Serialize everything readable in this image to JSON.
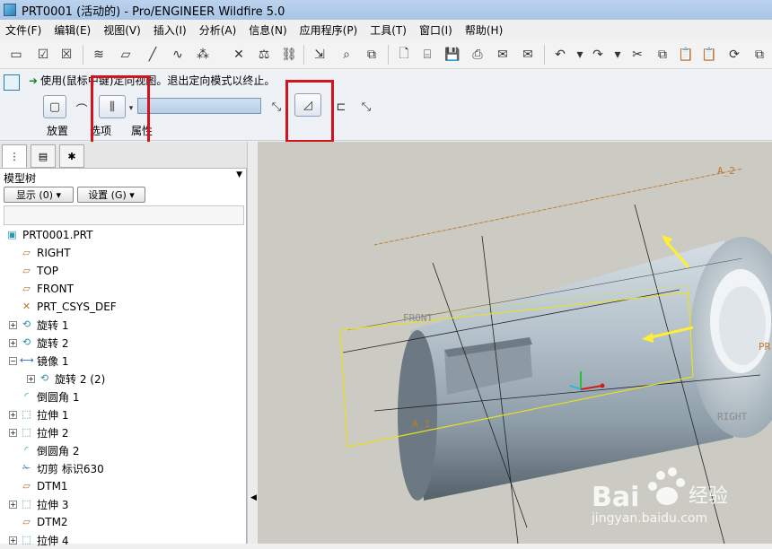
{
  "window": {
    "title": "PRT0001 (活动的) - Pro/ENGINEER Wildfire 5.0"
  },
  "menu": [
    "文件(F)",
    "编辑(E)",
    "视图(V)",
    "插入(I)",
    "分析(A)",
    "信息(N)",
    "应用程序(P)",
    "工具(T)",
    "窗口(I)",
    "帮助(H)"
  ],
  "dashboard": {
    "message": "使用(鼠标中键)定向视图。退出定向模式以终止。",
    "tabs": [
      "放置",
      "选项",
      "属性"
    ]
  },
  "panel": {
    "tree_header": "模型树",
    "show_button": "显示 (0) ▾",
    "settings_button": "设置 (G) ▾"
  },
  "tree": [
    {
      "label": "PRT0001.PRT",
      "icon": "part-icon",
      "expandable": false,
      "indent": 0
    },
    {
      "label": "RIGHT",
      "icon": "datum-plane-icon",
      "expandable": false,
      "indent": 1
    },
    {
      "label": "TOP",
      "icon": "datum-plane-icon",
      "expandable": false,
      "indent": 1
    },
    {
      "label": "FRONT",
      "icon": "datum-plane-icon",
      "expandable": false,
      "indent": 1
    },
    {
      "label": "PRT_CSYS_DEF",
      "icon": "csys-icon",
      "expandable": false,
      "indent": 1
    },
    {
      "label": "旋转 1",
      "icon": "revolve-icon",
      "expandable": true,
      "indent": 1
    },
    {
      "label": "旋转 2",
      "icon": "revolve-icon",
      "expandable": true,
      "indent": 1
    },
    {
      "label": "镜像 1",
      "icon": "mirror-icon",
      "expandable": true,
      "expanded": true,
      "indent": 1
    },
    {
      "label": "旋转 2 (2)",
      "icon": "revolve-icon",
      "expandable": true,
      "indent": 2
    },
    {
      "label": "倒圆角 1",
      "icon": "round-icon",
      "expandable": false,
      "indent": 1
    },
    {
      "label": "拉伸 1",
      "icon": "extrude-icon",
      "expandable": true,
      "indent": 1
    },
    {
      "label": "拉伸 2",
      "icon": "extrude-icon",
      "expandable": true,
      "indent": 1
    },
    {
      "label": "倒圆角 2",
      "icon": "round-icon",
      "expandable": false,
      "indent": 1
    },
    {
      "label": "切剪 标识630",
      "icon": "cut-icon",
      "expandable": false,
      "indent": 1
    },
    {
      "label": "DTM1",
      "icon": "datum-plane-icon",
      "expandable": false,
      "indent": 1
    },
    {
      "label": "拉伸 3",
      "icon": "extrude-icon",
      "expandable": true,
      "indent": 1
    },
    {
      "label": "DTM2",
      "icon": "datum-plane-icon",
      "expandable": false,
      "indent": 1
    },
    {
      "label": "拉伸 4",
      "icon": "extrude-icon",
      "expandable": true,
      "indent": 1
    }
  ],
  "viewport": {
    "datum_labels": [
      "A_2",
      "FRONT",
      "A_1",
      "RIGHT",
      "PR"
    ],
    "watermark_brand": "Bai",
    "watermark_brand2": "经验",
    "watermark_url": "jingyan.baidu.com"
  },
  "colors": {
    "highlight_box": "#d4141c",
    "datum_yellow": "#e8e020",
    "datum_orange": "#c07a30"
  }
}
